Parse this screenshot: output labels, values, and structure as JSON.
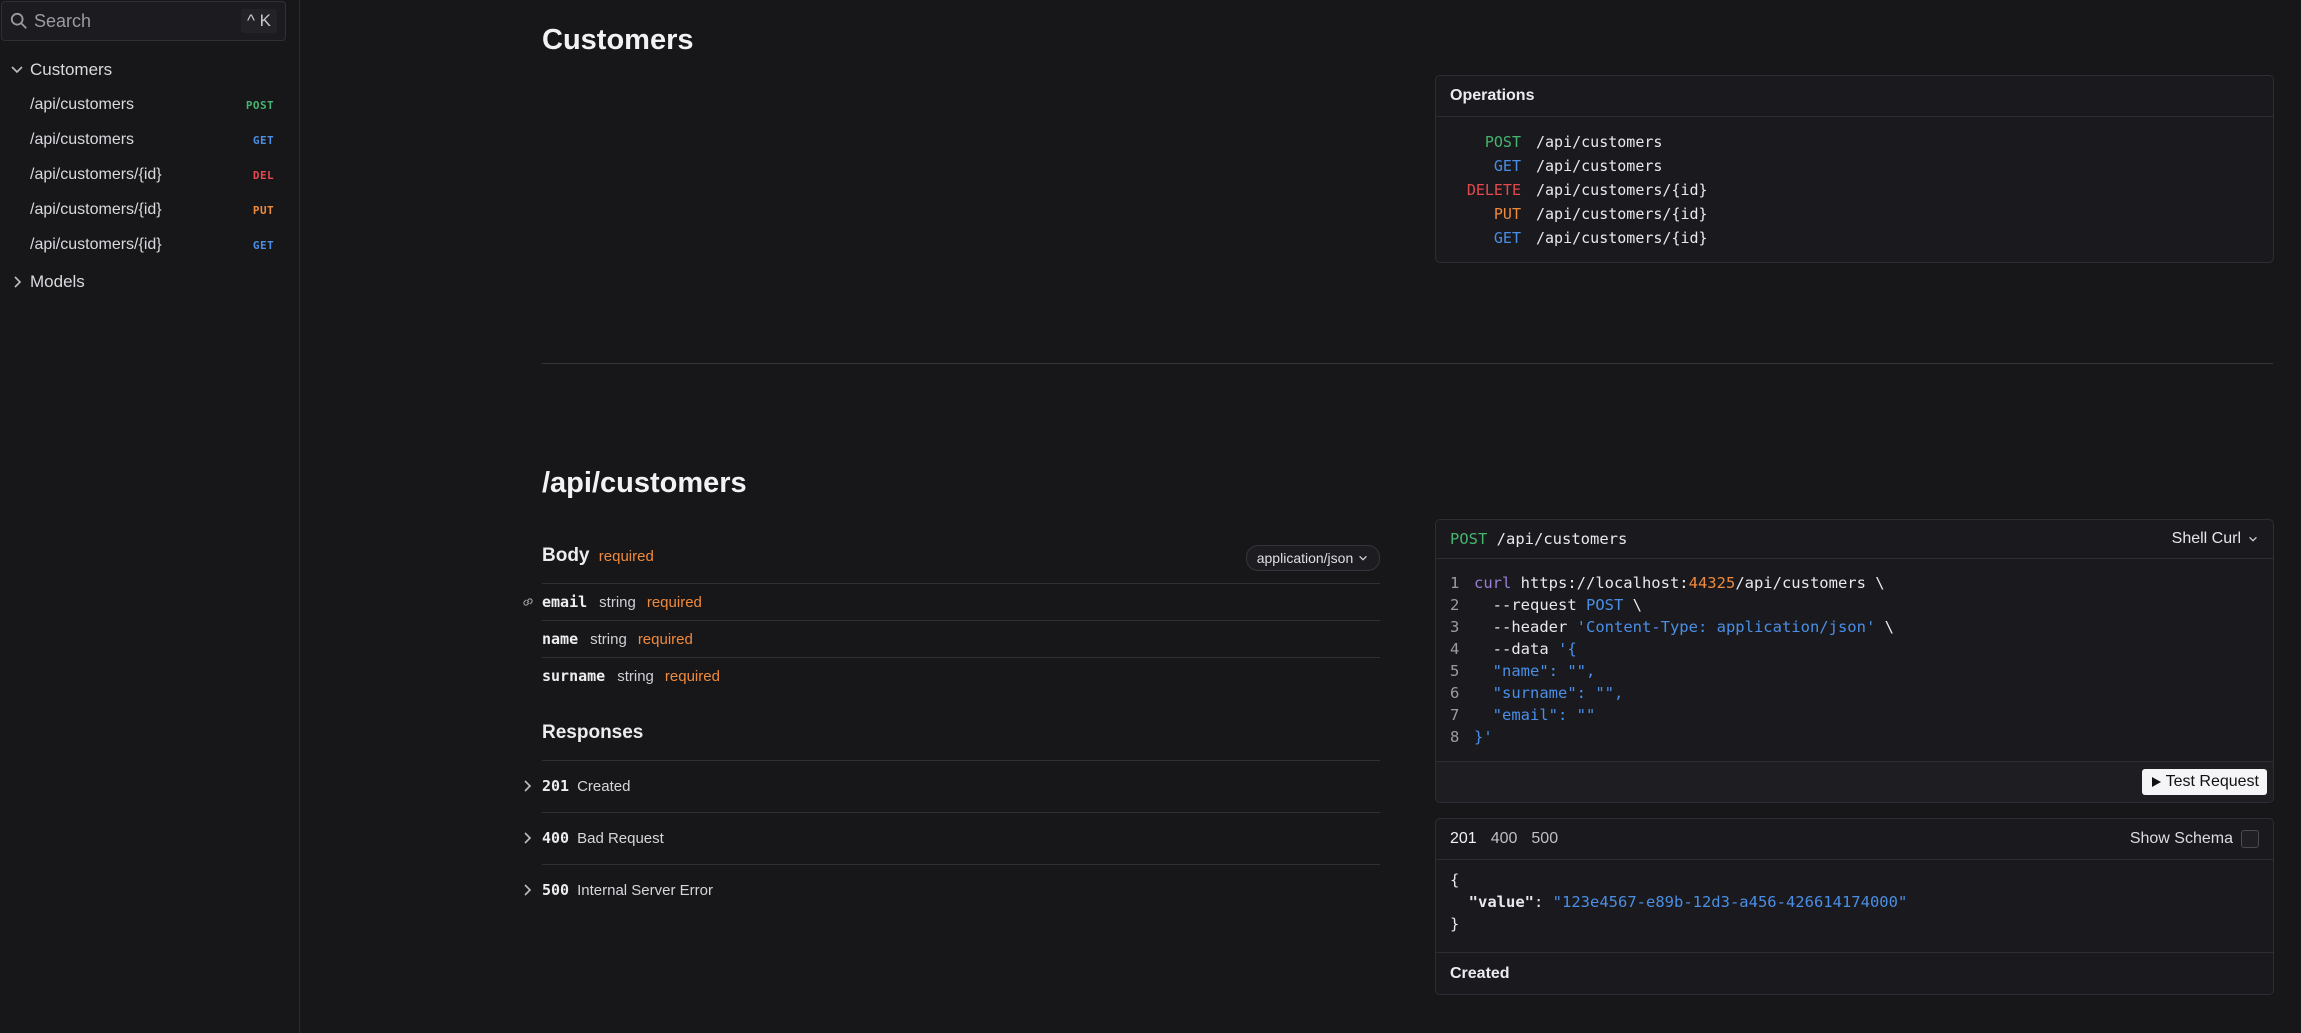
{
  "sidebar": {
    "search": {
      "placeholder": "Search",
      "shortcut": "^ K"
    },
    "groups": [
      {
        "label": "Customers",
        "expanded": true
      },
      {
        "label": "Models",
        "expanded": false
      }
    ],
    "items": [
      {
        "path": "/api/customers",
        "method": "POST"
      },
      {
        "path": "/api/customers",
        "method": "GET"
      },
      {
        "path": "/api/customers/{id}",
        "method": "DEL"
      },
      {
        "path": "/api/customers/{id}",
        "method": "PUT"
      },
      {
        "path": "/api/customers/{id}",
        "method": "GET"
      }
    ]
  },
  "section": {
    "title": "Customers",
    "operations_title": "Operations",
    "operations": [
      {
        "method": "POST",
        "path": "/api/customers"
      },
      {
        "method": "GET",
        "path": "/api/customers"
      },
      {
        "method": "DELETE",
        "path": "/api/customers/{id}"
      },
      {
        "method": "PUT",
        "path": "/api/customers/{id}"
      },
      {
        "method": "GET",
        "path": "/api/customers/{id}"
      }
    ]
  },
  "endpoint": {
    "title": "/api/customers",
    "body_label": "Body",
    "body_required": "required",
    "content_type": "application/json",
    "fields": [
      {
        "name": "email",
        "type": "string",
        "required": "required"
      },
      {
        "name": "name",
        "type": "string",
        "required": "required"
      },
      {
        "name": "surname",
        "type": "string",
        "required": "required"
      }
    ],
    "responses_label": "Responses",
    "responses": [
      {
        "code": "201",
        "desc": "Created"
      },
      {
        "code": "400",
        "desc": "Bad Request"
      },
      {
        "code": "500",
        "desc": "Internal Server Error"
      }
    ]
  },
  "request_panel": {
    "method": "POST",
    "path": "/api/customers",
    "client": "Shell Curl",
    "lines": [
      {
        "n": "1",
        "a": "curl",
        "b": " https://localhost:",
        "c": "44325",
        "d": "/api/customers \\"
      },
      {
        "n": "2",
        "a": "  --request ",
        "b": "POST",
        "c": " \\"
      },
      {
        "n": "3",
        "a": "  --header ",
        "b": "'Content-Type: application/json'",
        "c": " \\"
      },
      {
        "n": "4",
        "a": "  --data ",
        "b": "'{"
      },
      {
        "n": "5",
        "b": "  \"name\": \"\","
      },
      {
        "n": "6",
        "b": "  \"surname\": \"\","
      },
      {
        "n": "7",
        "b": "  \"email\": \"\""
      },
      {
        "n": "8",
        "b": "}'"
      }
    ],
    "test_button": "Test Request"
  },
  "response_panel": {
    "tabs": [
      "201",
      "400",
      "500"
    ],
    "show_schema": "Show Schema",
    "json": {
      "open": "{",
      "key": "\"value\"",
      "colon": ": ",
      "value": "\"123e4567-e89b-12d3-a456-426614174000\"",
      "close": "}"
    },
    "status": "Created"
  },
  "colors": {
    "post": "#46b36e",
    "get": "#4a8ee6",
    "delete": "#e5484d",
    "put": "#f08a3c",
    "background": "#17171a"
  }
}
